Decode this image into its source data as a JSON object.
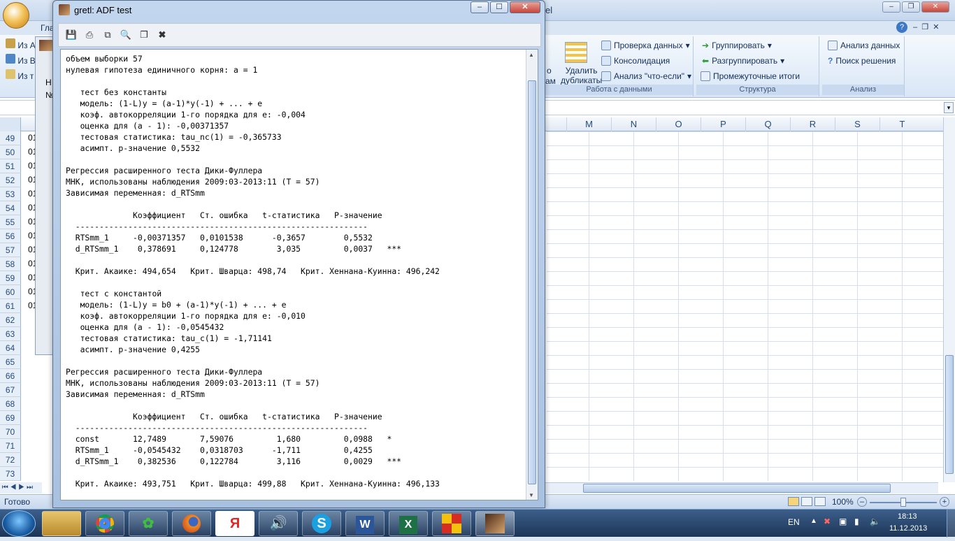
{
  "excel": {
    "title_suffix": "el",
    "tab_visible": "Гла",
    "ribbon": {
      "remove_duplicates": "Удалить\nдубликаты",
      "remove_dup_line1": "Удалить",
      "remove_dup_line2": "дубликаты",
      "partial_text": "о",
      "partial_text2": "ам",
      "data_check": "Проверка данных",
      "consolidation": "Консолидация",
      "what_if": "Анализ \"что-если\"",
      "group_data_label": "Работа с данными",
      "group": "Группировать",
      "ungroup": "Разгруппировать",
      "subtotals": "Промежуточные итоги",
      "group_structure_label": "Структура",
      "data_analysis": "Анализ данных",
      "solver": "Поиск решения",
      "group_analysis_label": "Анализ",
      "left_items": [
        "Из А",
        "Из В",
        "Из т"
      ]
    },
    "columns": [
      "M",
      "N",
      "O",
      "P",
      "Q",
      "R",
      "S",
      "T"
    ],
    "rows": [
      "49",
      "50",
      "51",
      "52",
      "53",
      "54",
      "55",
      "56",
      "57",
      "58",
      "59",
      "60",
      "61",
      "62",
      "63",
      "64",
      "65",
      "66",
      "67",
      "68",
      "69",
      "70",
      "71",
      "72",
      "73"
    ],
    "row_cells": [
      "01",
      "01",
      "01",
      "01",
      "01",
      "01",
      "01",
      "01",
      "01",
      "01",
      "01",
      "01",
      "01"
    ],
    "status_ready": "Готово",
    "zoom": "100%"
  },
  "back_window": {
    "labels": [
      "Н",
      "№"
    ]
  },
  "gretl": {
    "title": "gretl: ADF test",
    "toolbar_icons": [
      "save-icon",
      "print-icon",
      "copy-icon",
      "find-icon",
      "window-icon",
      "close-doc-icon"
    ],
    "output_lines": [
      "объем выборки 57",
      "нулевая гипотеза единичного корня: a = 1",
      "",
      "   тест без константы",
      "   модель: (1-L)y = (a-1)*y(-1) + ... + e",
      "   коэф. автокорреляции 1-го порядка для e: -0,004",
      "   оценка для (a - 1): -0,00371357",
      "   тестовая статистика: tau_nc(1) = -0,365733",
      "   асимпт. p-значение 0,5532",
      "",
      "Регрессия расширенного теста Дики-Фуллера",
      "МНК, использованы наблюдения 2009:03-2013:11 (T = 57)",
      "Зависимая переменная: d_RTSmm",
      "",
      "              Коэффициент   Ст. ошибка   t-статистика   P-значение",
      "  -------------------------------------------------------------",
      "  RTSmm_1     -0,00371357   0,0101538      -0,3657        0,5532",
      "  d_RTSmm_1    0,378691     0,124778        3,035         0,0037   ***",
      "",
      "  Крит. Акаике: 494,654   Крит. Шварца: 498,74   Крит. Хеннана-Куинна: 496,242",
      "",
      "   тест с константой",
      "   модель: (1-L)y = b0 + (a-1)*y(-1) + ... + e",
      "   коэф. автокорреляции 1-го порядка для e: -0,010",
      "   оценка для (a - 1): -0,0545432",
      "   тестовая статистика: tau_c(1) = -1,71141",
      "   асимпт. p-значение 0,4255",
      "",
      "Регрессия расширенного теста Дики-Фуллера",
      "МНК, использованы наблюдения 2009:03-2013:11 (T = 57)",
      "Зависимая переменная: d_RTSmm",
      "",
      "              Коэффициент   Ст. ошибка   t-статистика   P-значение",
      "  -------------------------------------------------------------",
      "  const       12,7489       7,59076         1,680         0,0988   *",
      "  RTSmm_1     -0,0545432    0,0318703      -1,711         0,4255",
      "  d_RTSmm_1    0,382536     0,122784        3,116         0,0029   ***",
      "",
      "  Крит. Акаике: 493,751   Крит. Шварца: 499,88   Крит. Хеннана-Куинна: 496,133"
    ]
  },
  "taskbar": {
    "apps": [
      "explorer-icon",
      "chrome-icon",
      "icq-icon",
      "firefox-icon",
      "yandex-icon",
      "media-icon",
      "skype-icon",
      "word-icon",
      "excel-icon",
      "gretl-grid-icon",
      "gretl-icon"
    ],
    "yandex_letter": "Я",
    "skype_letter": "S",
    "word_letter": "W",
    "excel_letter": "X",
    "lang": "EN",
    "time": "18:13",
    "date": "11.12.2013"
  }
}
